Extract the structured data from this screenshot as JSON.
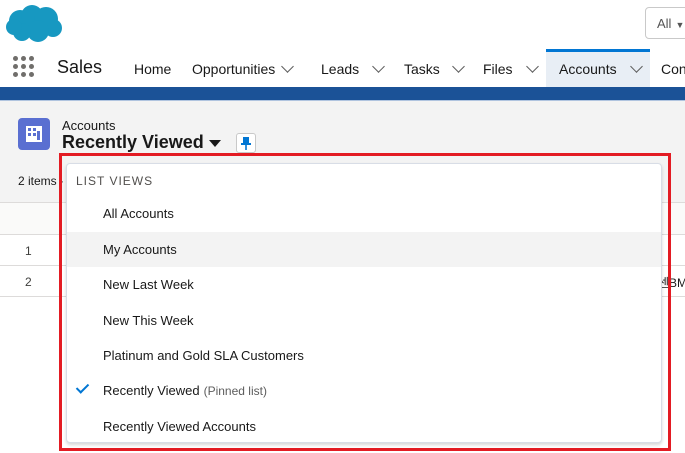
{
  "header": {
    "logo_icon": "salesforce-cloud-logo",
    "search_scope": "All"
  },
  "nav": {
    "app_name": "Sales",
    "tabs": [
      {
        "label": "Home",
        "has_menu": false
      },
      {
        "label": "Opportunities",
        "has_menu": true
      },
      {
        "label": "Leads",
        "has_menu": true
      },
      {
        "label": "Tasks",
        "has_menu": true
      },
      {
        "label": "Files",
        "has_menu": true
      },
      {
        "label": "Accounts",
        "has_menu": true,
        "active": true
      },
      {
        "label": "Con",
        "has_menu": false
      }
    ]
  },
  "list_header": {
    "object_label": "Accounts",
    "list_view_name": "Recently Viewed",
    "item_count": "2 items ·"
  },
  "table": {
    "rows": [
      {
        "num": "1",
        "fragment": ""
      },
      {
        "num": "2",
        "fragment": "센BM"
      }
    ]
  },
  "dropdown": {
    "section_label": "LIST VIEWS",
    "options": [
      {
        "label": "All Accounts",
        "suffix": "",
        "selected": false,
        "hover": false
      },
      {
        "label": "My Accounts",
        "suffix": "",
        "selected": false,
        "hover": true
      },
      {
        "label": "New Last Week",
        "suffix": "",
        "selected": false,
        "hover": false
      },
      {
        "label": "New This Week",
        "suffix": "",
        "selected": false,
        "hover": false
      },
      {
        "label": "Platinum and Gold SLA Customers",
        "suffix": "",
        "selected": false,
        "hover": false
      },
      {
        "label": "Recently Viewed",
        "suffix": "(Pinned list)",
        "selected": true,
        "hover": false
      },
      {
        "label": "Recently Viewed Accounts",
        "suffix": "",
        "selected": false,
        "hover": false
      }
    ]
  },
  "colors": {
    "brand_blue": "#0176d3",
    "nav_bar_blue": "#1b5297",
    "object_icon": "#5a6fd1",
    "highlight_red": "#e31b23"
  }
}
